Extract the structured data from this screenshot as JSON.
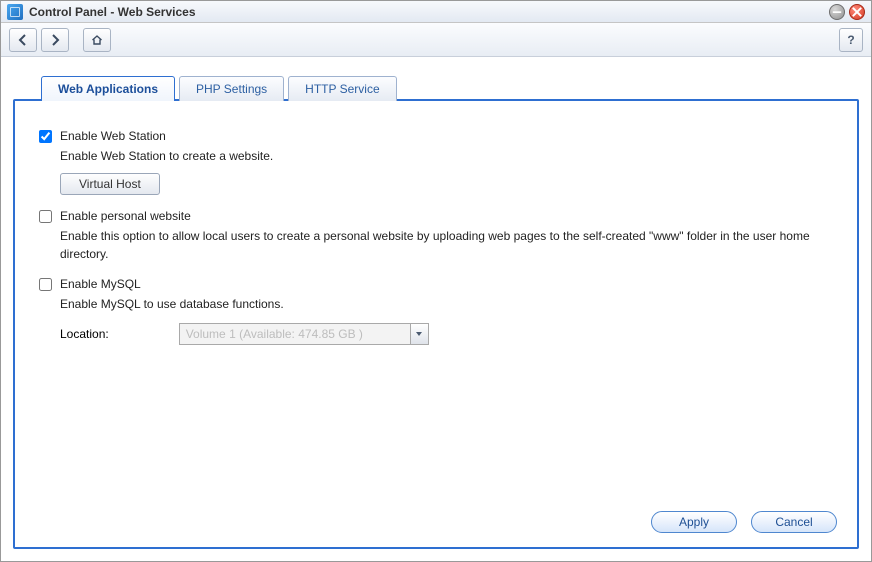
{
  "window": {
    "title": "Control Panel - Web Services"
  },
  "toolbar": {
    "help_label": "?"
  },
  "tabs": [
    {
      "label": "Web Applications"
    },
    {
      "label": "PHP Settings"
    },
    {
      "label": "HTTP Service"
    }
  ],
  "webstation": {
    "checkbox_label": "Enable Web Station",
    "checked": true,
    "description": "Enable Web Station to create a website.",
    "virtual_host_label": "Virtual Host"
  },
  "personal": {
    "checkbox_label": "Enable personal website",
    "checked": false,
    "description": "Enable this option to allow local users to create a personal website by uploading web pages to the self-created \"www\" folder in the user home directory."
  },
  "mysql": {
    "checkbox_label": "Enable MySQL",
    "checked": false,
    "description": "Enable MySQL to use database functions.",
    "location_label": "Location:",
    "location_value": "Volume 1 (Available: 474.85 GB )"
  },
  "footer": {
    "apply_label": "Apply",
    "cancel_label": "Cancel"
  }
}
